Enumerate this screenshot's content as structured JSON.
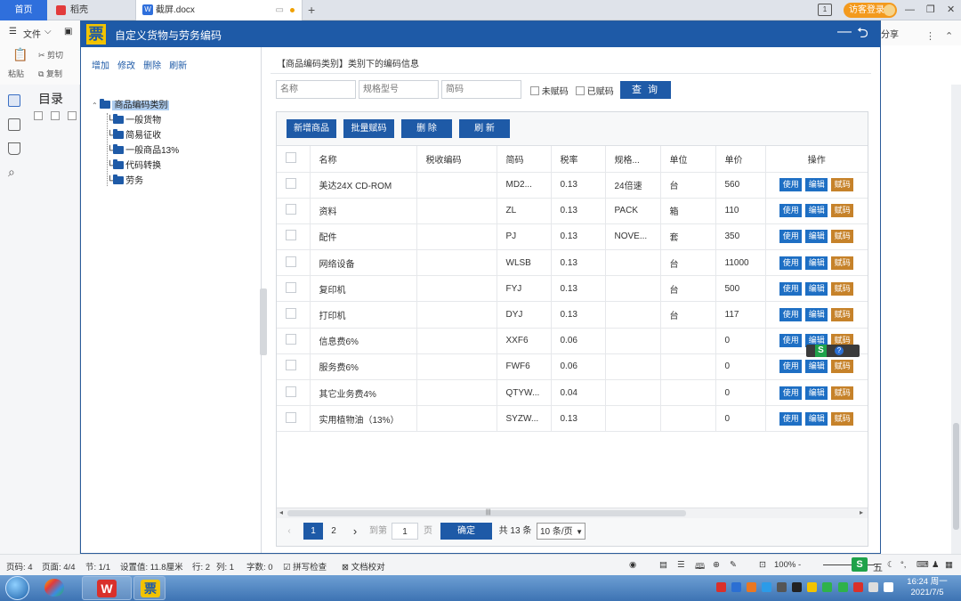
{
  "browser": {
    "tabs": [
      {
        "label": "首页"
      },
      {
        "label": "稻壳"
      },
      {
        "label": "截屏.docx"
      }
    ],
    "new_tab": "+",
    "login_label": "访客登录",
    "page_count_box": "1"
  },
  "wps": {
    "file_menu": "文件",
    "paste": "粘贴",
    "cut": "剪切",
    "copy": "复制",
    "share": "分享",
    "toc_title": "目录"
  },
  "dialog": {
    "title": "自定义货物与劳务编码",
    "tree_actions": [
      "增加",
      "修改",
      "删除",
      "刷新"
    ],
    "tree": {
      "root": "商品编码类别",
      "children": [
        "一般货物",
        "简易征收",
        "一般商品13%",
        "代码转换",
        "劳务"
      ]
    },
    "breadcrumb": "【商品编码类别】类别下的编码信息",
    "search": {
      "name_placeholder": "名称",
      "spec_placeholder": "规格型号",
      "code_placeholder": "简码",
      "unassigned": "未赋码",
      "assigned": "已赋码",
      "query": "查 询"
    },
    "buttons": {
      "new_item": "新增商品",
      "batch_code": "批量赋码",
      "delete": "删 除",
      "refresh": "刷 新"
    },
    "columns": [
      "名称",
      "税收编码",
      "简码",
      "税率",
      "规格...",
      "单位",
      "单价",
      "操作"
    ],
    "rows": [
      {
        "name": "美达24X CD-ROM",
        "tax_code": "",
        "short": "MD2...",
        "rate": "0.13",
        "spec": "24倍速",
        "unit": "台",
        "price": "560"
      },
      {
        "name": "资料",
        "tax_code": "",
        "short": "ZL",
        "rate": "0.13",
        "spec": "PACK",
        "unit": "箱",
        "price": "110"
      },
      {
        "name": "配件",
        "tax_code": "",
        "short": "PJ",
        "rate": "0.13",
        "spec": "NOVE...",
        "unit": "套",
        "price": "350"
      },
      {
        "name": "网络设备",
        "tax_code": "",
        "short": "WLSB",
        "rate": "0.13",
        "spec": "",
        "unit": "台",
        "price": "11000"
      },
      {
        "name": "复印机",
        "tax_code": "",
        "short": "FYJ",
        "rate": "0.13",
        "spec": "",
        "unit": "台",
        "price": "500"
      },
      {
        "name": "打印机",
        "tax_code": "",
        "short": "DYJ",
        "rate": "0.13",
        "spec": "",
        "unit": "台",
        "price": "117"
      },
      {
        "name": "信息费6%",
        "tax_code": "",
        "short": "XXF6",
        "rate": "0.06",
        "spec": "",
        "unit": "",
        "price": "0"
      },
      {
        "name": "服务费6%",
        "tax_code": "",
        "short": "FWF6",
        "rate": "0.06",
        "spec": "",
        "unit": "",
        "price": "0"
      },
      {
        "name": "其它业务费4%",
        "tax_code": "",
        "short": "QTYW...",
        "rate": "0.04",
        "spec": "",
        "unit": "",
        "price": "0"
      },
      {
        "name": "实用植物油（13%）",
        "tax_code": "",
        "short": "SYZW...",
        "rate": "0.13",
        "spec": "",
        "unit": "",
        "price": "0"
      }
    ],
    "ops": {
      "use": "使用",
      "edit": "编辑",
      "code": "赋码"
    },
    "pager": {
      "current": "1",
      "next_page": "2",
      "goto": "到第",
      "goto_value": "1",
      "page_unit": "页",
      "ok": "确定",
      "total": "共 13 条",
      "per_page": "10 条/页"
    }
  },
  "statusbar": {
    "page_num": "页码: 4",
    "pages": "页面: 4/4",
    "section": "节: 1/1",
    "setting": "设置值: 11.8厘米",
    "row": "行: 2",
    "col": "列: 1",
    "words": "字数: 0",
    "spell": "拼写检查",
    "proof": "文档校对",
    "zoom": "100%",
    "ime": "五"
  },
  "taskbar": {
    "time": "16:24 周一",
    "date": "2021/7/5"
  }
}
